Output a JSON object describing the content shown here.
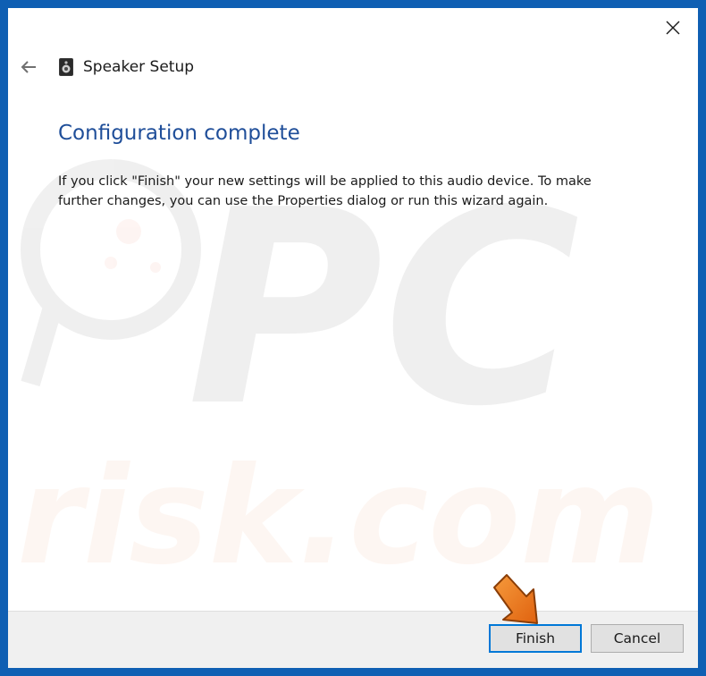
{
  "window": {
    "title": "Speaker Setup"
  },
  "page": {
    "heading": "Configuration complete",
    "body": "If you click \"Finish\" your new settings will be applied to this audio device.  To make further changes, you can use the Properties dialog or run this wizard again."
  },
  "buttons": {
    "finish_label": "Finish",
    "cancel_label": "Cancel"
  },
  "watermark": {
    "text_line1": "PC",
    "text_line2": "risk.com"
  },
  "colors": {
    "frame": "#0f5fb3",
    "heading": "#1f4e99",
    "focus_border": "#0078d7",
    "pointer_arrow": "#f07b1c"
  },
  "icons": {
    "close": "close-icon",
    "back": "back-arrow-icon",
    "app": "speaker-icon",
    "pointer": "pointer-arrow-icon"
  }
}
